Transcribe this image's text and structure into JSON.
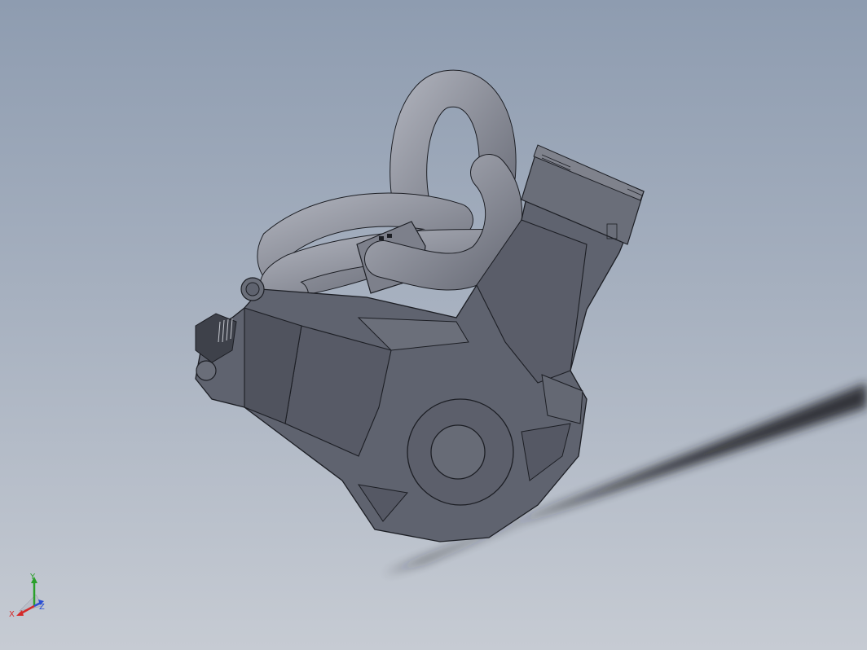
{
  "viewport": {
    "background_top": "#8e9cb0",
    "background_bottom": "#c6cbd3"
  },
  "model": {
    "body_color": "#5f636f",
    "body_dark": "#4d505b",
    "tube_color": "#8e919c",
    "edge_color": "#1c1e24",
    "shadow_color": "#1d1f22"
  },
  "triad": {
    "x_label": "X",
    "y_label": "Y",
    "z_label": "Z",
    "x_color": "#d42a2a",
    "y_color": "#2aa02a",
    "z_color": "#2a4fd4"
  }
}
